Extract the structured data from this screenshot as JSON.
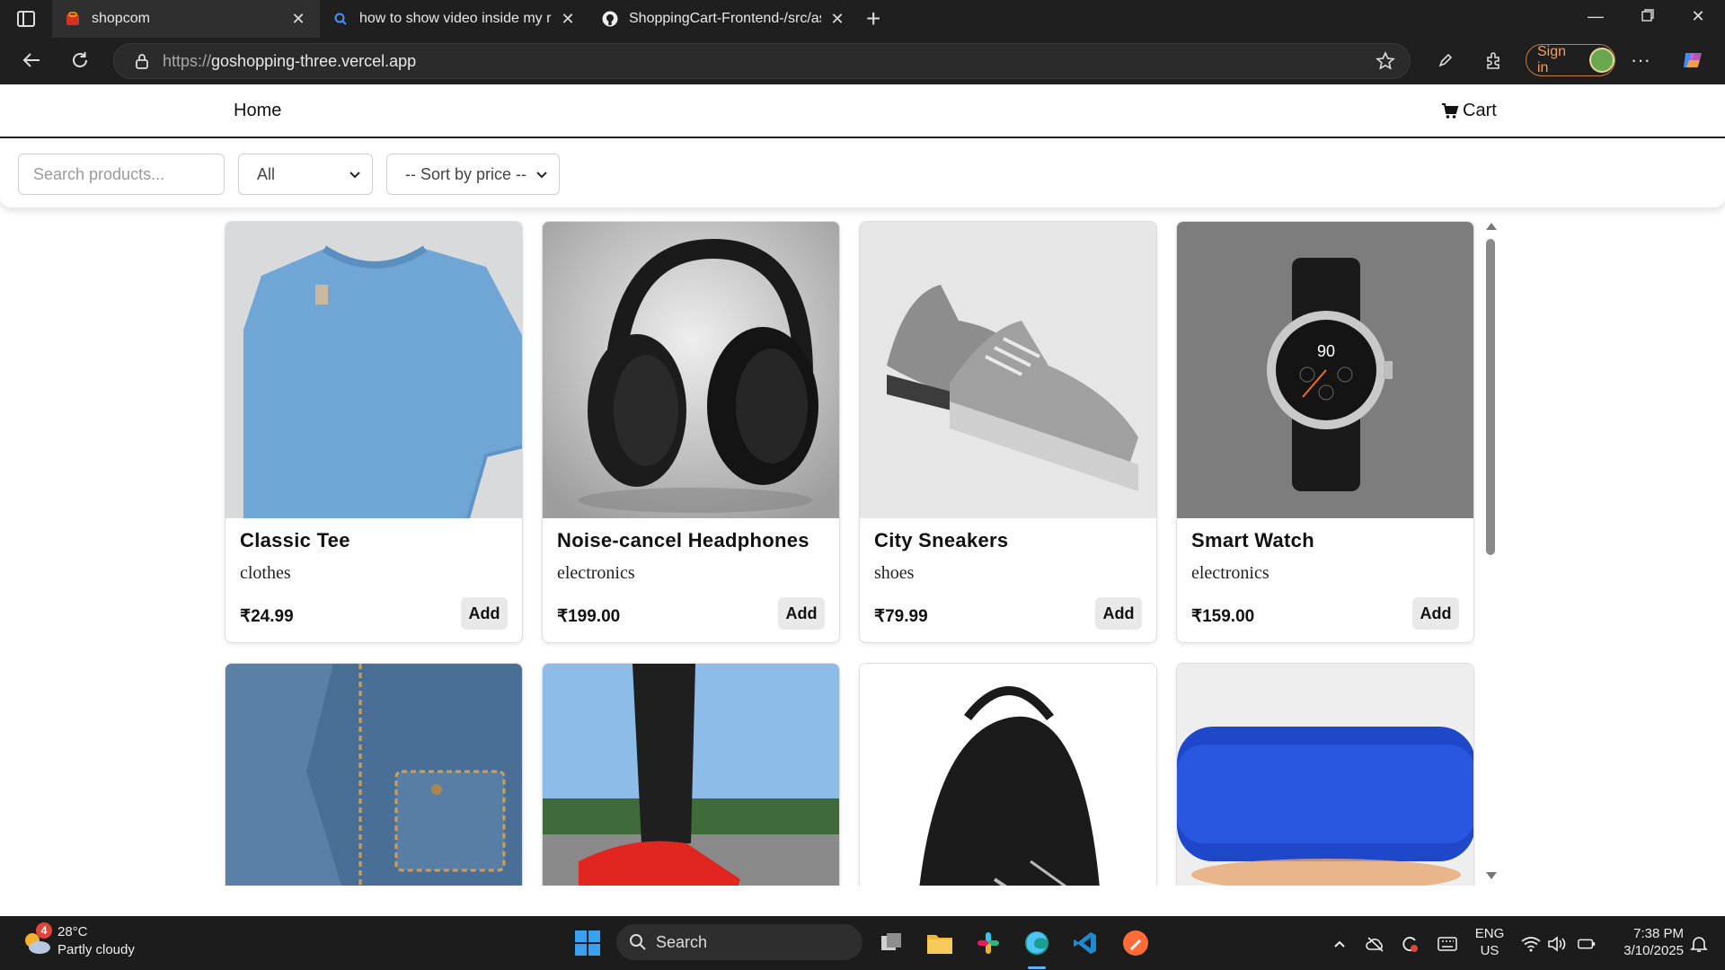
{
  "browser": {
    "tabs": [
      {
        "title": "shopcom",
        "active": true
      },
      {
        "title": "how to show video inside my reac",
        "active": false
      },
      {
        "title": "ShoppingCart-Frontend-/src/asse",
        "active": false
      }
    ],
    "url_scheme": "https://",
    "url_host": "goshopping-three.vercel.app",
    "signin_label": "Sign in"
  },
  "app": {
    "nav": {
      "home": "Home",
      "cart": "Cart"
    },
    "filters": {
      "search_placeholder": "Search products...",
      "category_selected": "All",
      "sort_selected": "-- Sort by price --"
    },
    "products": [
      {
        "name": "Classic Tee",
        "category": "clothes",
        "price": "₹24.99",
        "add_label": "Add"
      },
      {
        "name": "Noise-cancel Headphones",
        "category": "electronics",
        "price": "₹199.00",
        "add_label": "Add"
      },
      {
        "name": "City Sneakers",
        "category": "shoes",
        "price": "₹79.99",
        "add_label": "Add"
      },
      {
        "name": "Smart Watch",
        "category": "electronics",
        "price": "₹159.00",
        "add_label": "Add"
      }
    ]
  },
  "taskbar": {
    "weather_badge": "4",
    "weather_temp": "28°C",
    "weather_desc": "Partly cloudy",
    "search_label": "Search",
    "lang": "ENG",
    "region": "US",
    "time": "7:38 PM",
    "date": "3/10/2025"
  },
  "colors": {
    "accent": "#5fb2ff",
    "signin_border": "#c77c3b"
  }
}
